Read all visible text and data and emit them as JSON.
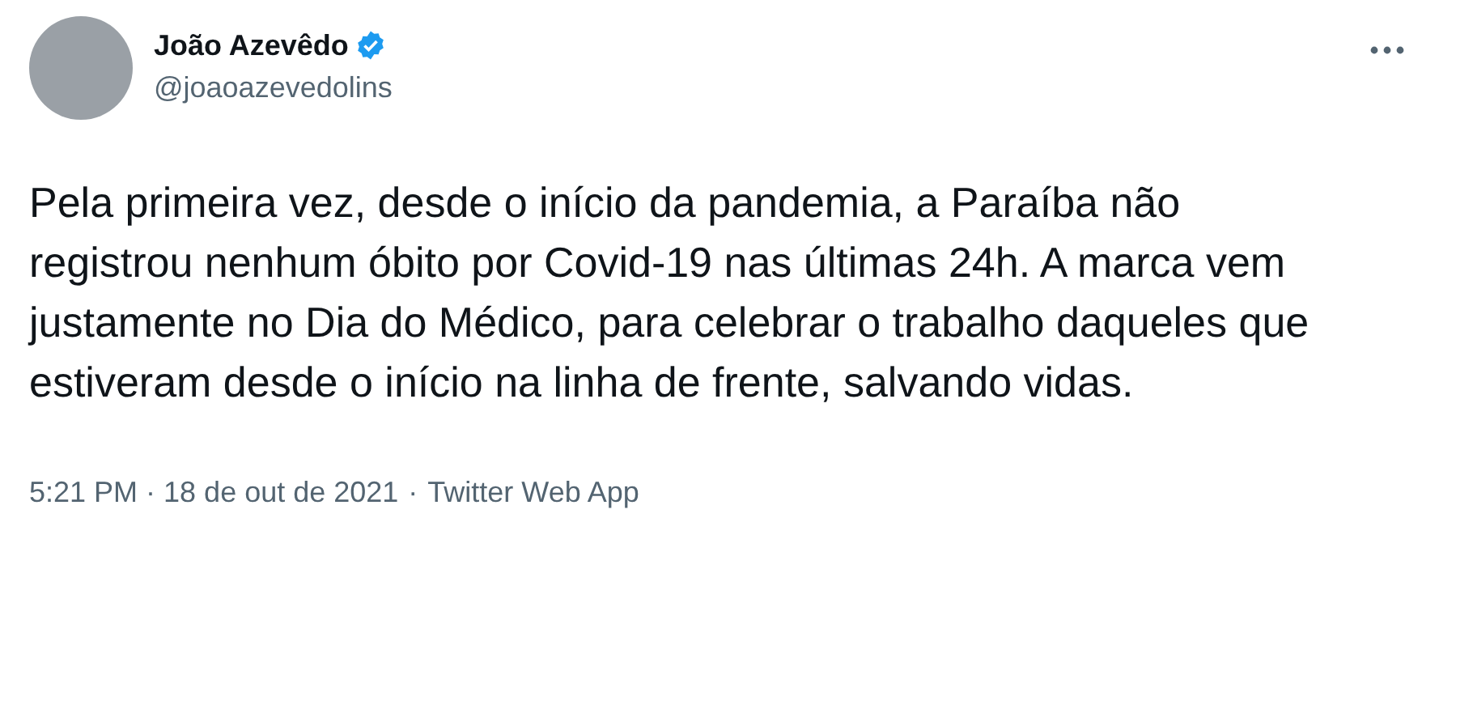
{
  "author": {
    "name": "João Azevêdo",
    "verified": true,
    "handle": "@joaoazevedolins"
  },
  "text": "Pela primeira vez, desde o início da pandemia, a Paraíba não registrou nenhum óbito por Covid-19 nas últimas 24h. A marca vem justamente no Dia do Médico, para celebrar o trabalho daqueles que estiveram desde o início na linha de frente, salvando vidas.",
  "footer": {
    "timestamp": "5:21 PM · 18 de out de 2021",
    "separator": "·",
    "source": "Twitter Web App"
  }
}
